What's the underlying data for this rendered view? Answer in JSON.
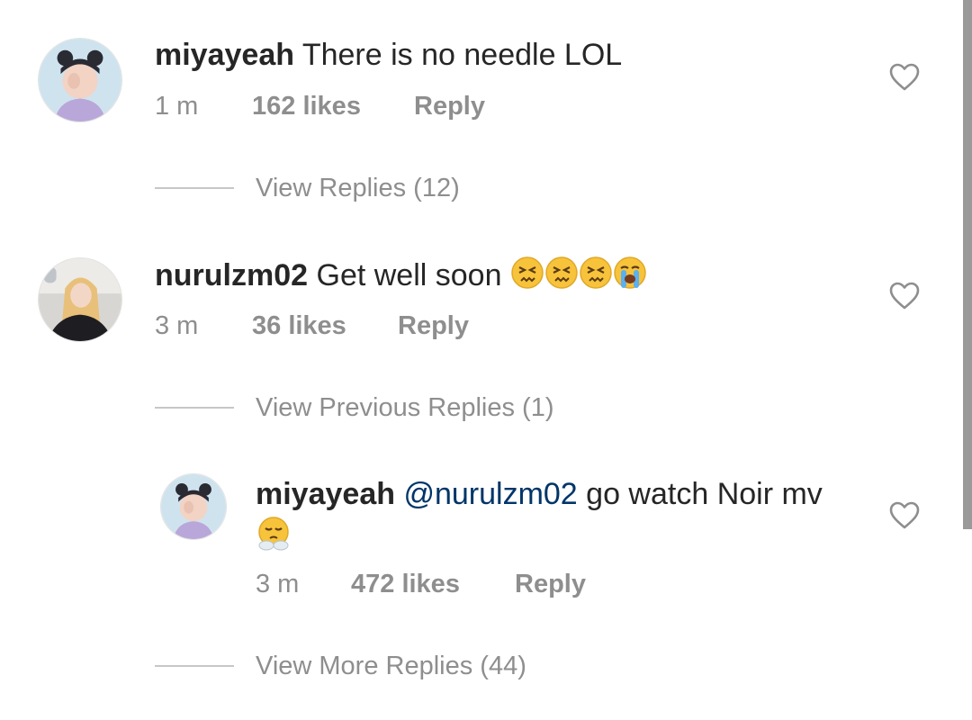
{
  "comments": [
    {
      "username": "miyayeah",
      "text": "There is no needle LOL",
      "time": "1 m",
      "likes": "162 likes",
      "reply_label": "Reply",
      "replies_link": "View Replies (12)"
    },
    {
      "username": "nurulzm02",
      "text": "Get well soon",
      "emojis": [
        "persevering-face",
        "persevering-face",
        "persevering-face",
        "loudly-crying-face"
      ],
      "time": "3 m",
      "likes": "36 likes",
      "reply_label": "Reply",
      "replies_link": "View Previous Replies (1)"
    }
  ],
  "reply": {
    "username": "miyayeah",
    "mention": "@nurulzm02",
    "text": "go watch Noir mv",
    "emoji": "face-with-steam-from-nose",
    "time": "3 m",
    "likes": "472 likes",
    "reply_label": "Reply",
    "replies_link": "View More Replies (44)"
  },
  "colors": {
    "text": "#262626",
    "meta": "#8e8e8e",
    "mention": "#003569",
    "divider": "#c7c7c7"
  }
}
